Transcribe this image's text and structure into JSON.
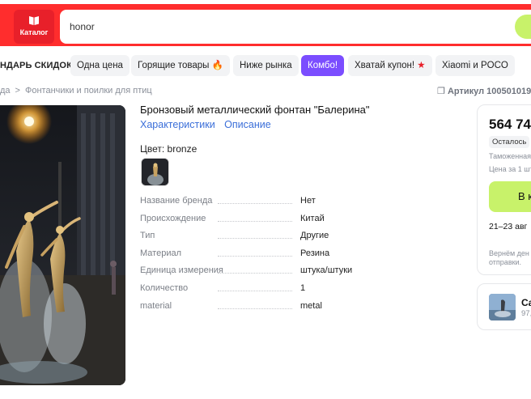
{
  "header": {
    "catalog_label": "Каталог",
    "search_value": "honor"
  },
  "promo": {
    "items": [
      "НДАРЬ СКИДОК",
      "Одна цена",
      "Горящие товары 🔥",
      "Ниже рынка",
      "Комбо!",
      "Хватай купон!",
      "Xiaomi и POCO"
    ]
  },
  "breadcrumb": {
    "items": [
      "да",
      "Фонтанчики и поилки для птиц"
    ],
    "separator": ">",
    "article": "Артикул 100501019"
  },
  "product": {
    "title": "Бронзовый металлический фонтан \"Балерина\"",
    "tabs": [
      "Характеристики",
      "Описание"
    ],
    "color_label": "Цвет: bronze",
    "specs": [
      {
        "name": "Название бренда",
        "value": "Нет"
      },
      {
        "name": "Происхождение",
        "value": "Китай"
      },
      {
        "name": "Тип",
        "value": "Другие"
      },
      {
        "name": "Материал",
        "value": "Резина"
      },
      {
        "name": "Единица измерения",
        "value": "штука/штуки"
      },
      {
        "name": "Количество",
        "value": "1"
      },
      {
        "name": "material",
        "value": "metal"
      }
    ]
  },
  "buy": {
    "price": "564 74",
    "stock": "Осталось",
    "customs": "Таможенная",
    "unit_price": "Цена за 1 шт",
    "cart_label": "В к",
    "delivery": "21–23 авг",
    "return_line1": "Вернём ден",
    "return_line2": "отправки."
  },
  "seller": {
    "name": "Ca",
    "rating": "97,"
  },
  "colors": {
    "header_red": "#ff2d2d",
    "accent_lime": "#c8f26a",
    "combo_purple": "#7b4dff",
    "link_blue": "#3b6fd9"
  }
}
